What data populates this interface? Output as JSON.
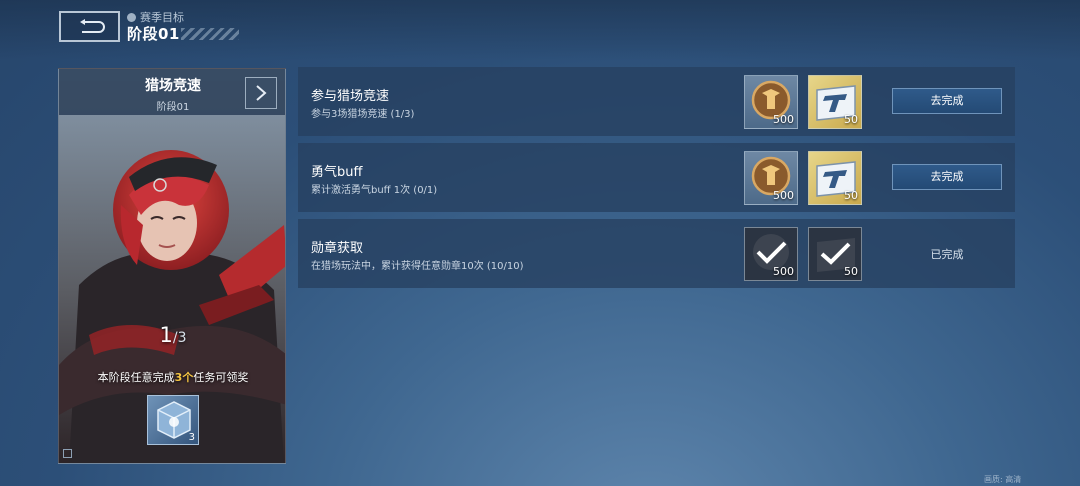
{
  "header": {
    "breadcrumb": "赛季目标",
    "title": "阶段01"
  },
  "mode_card": {
    "name": "猎场竞速",
    "stage": "阶段01",
    "progress_current": "1",
    "progress_total": "3",
    "rule_prefix": "本阶段任意完成",
    "rule_highlight": "3个",
    "rule_suffix": "任务可领奖",
    "crate_count": "3",
    "highlight_color": "#f5c542"
  },
  "missions": [
    {
      "title": "参与猎场竞速",
      "desc": "参与3场猎场竞速 (1/3)",
      "rewards": [
        {
          "icon": "coin-reward-icon",
          "qty": "500"
        },
        {
          "icon": "ticket-reward-icon",
          "qty": "50"
        }
      ],
      "action": "去完成",
      "status": "incomplete"
    },
    {
      "title": "勇气buff",
      "desc": "累计激活勇气buff 1次 (0/1)",
      "rewards": [
        {
          "icon": "coin-reward-icon",
          "qty": "500"
        },
        {
          "icon": "ticket-reward-icon",
          "qty": "50"
        }
      ],
      "action": "去完成",
      "status": "incomplete"
    },
    {
      "title": "勋章获取",
      "desc": "在猎场玩法中，累计获得任意勋章10次 (10/10)",
      "rewards": [
        {
          "icon": "claimed-check-icon",
          "qty": "500"
        },
        {
          "icon": "claimed-check-icon",
          "qty": "50"
        }
      ],
      "action": "已完成",
      "status": "completed"
    }
  ],
  "footer": {
    "right_text": "画质: 高清"
  }
}
